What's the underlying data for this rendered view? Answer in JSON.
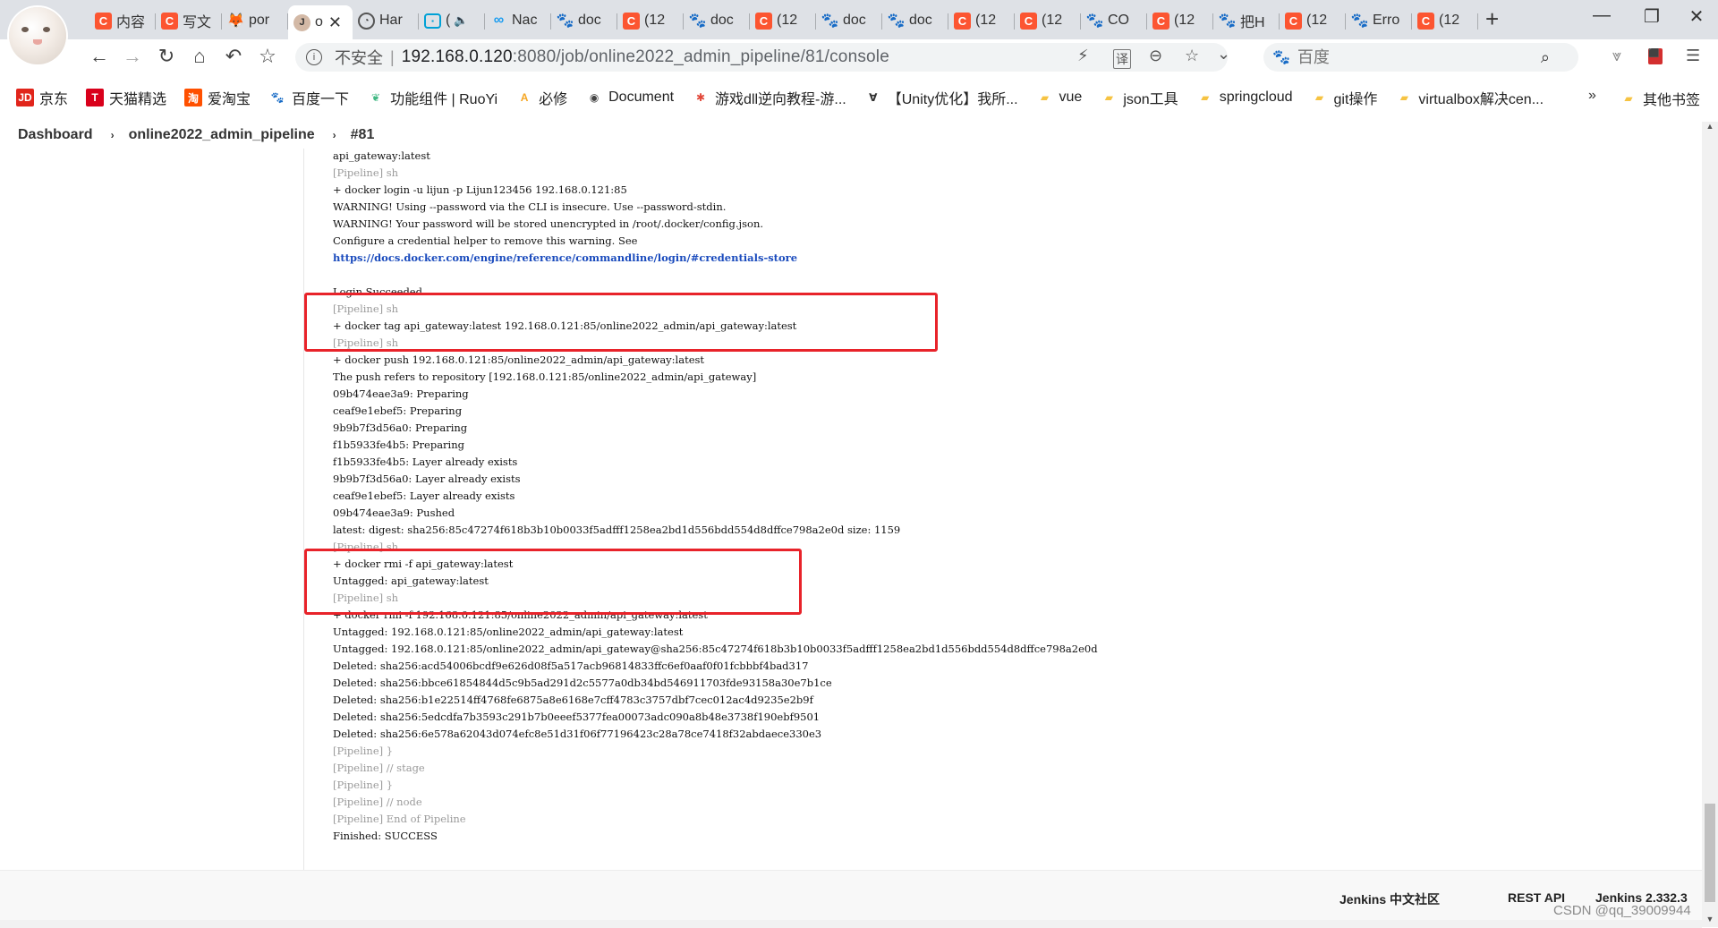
{
  "browser": {
    "tabs": [
      {
        "icon": "csdn",
        "title": "内容"
      },
      {
        "icon": "csdn",
        "title": "写文"
      },
      {
        "icon": "gitlab",
        "title": "por"
      },
      {
        "icon": "jenkins",
        "title": "o",
        "active": true,
        "close": "✕"
      },
      {
        "icon": "github",
        "title": "Har"
      },
      {
        "icon": "bilibili",
        "title": "(",
        "audio": "🔈"
      },
      {
        "icon": "nacos",
        "title": "Nac"
      },
      {
        "icon": "baidu",
        "title": "doc"
      },
      {
        "icon": "csdn",
        "title": "(12"
      },
      {
        "icon": "baidu",
        "title": "doc"
      },
      {
        "icon": "csdn",
        "title": "(12"
      },
      {
        "icon": "baidu",
        "title": "doc"
      },
      {
        "icon": "baidu",
        "title": "doc"
      },
      {
        "icon": "csdn",
        "title": "(12"
      },
      {
        "icon": "csdn",
        "title": "(12"
      },
      {
        "icon": "baidu",
        "title": "CO"
      },
      {
        "icon": "csdn",
        "title": "(12"
      },
      {
        "icon": "baidu",
        "title": "把H"
      },
      {
        "icon": "csdn",
        "title": "(12"
      },
      {
        "icon": "baidu",
        "title": "Erro"
      },
      {
        "icon": "csdn",
        "title": "(12"
      }
    ],
    "new_tab": "+",
    "window": {
      "minimize": "—",
      "restore": "❐",
      "close": "✕"
    },
    "nav": {
      "back": "←",
      "forward": "→",
      "reload": "↻",
      "home": "⌂",
      "undo": "↶",
      "bookmark": "☆"
    },
    "address": {
      "security_label": "不安全",
      "host": "192.168.0.120",
      "rest": ":8080/job/online2022_admin_pipeline/81/console"
    },
    "omni_icons": {
      "lightning": "⚡",
      "translate": "译",
      "zoom": "⊖",
      "star": "☆",
      "dropdown": "⌄"
    },
    "search": {
      "placeholder": "百度",
      "engine_icon": "🐾",
      "go": "⌕"
    },
    "toolbar_right": {
      "extension": "⩔",
      "pdf": "⬛",
      "menu": "☰"
    },
    "bookmarks": [
      {
        "icon": "JD",
        "color": "#e1251b",
        "label": "京东"
      },
      {
        "icon": "T",
        "color": "#d9001b",
        "label": "天猫精选"
      },
      {
        "icon": "淘",
        "color": "#ff5000",
        "label": "爱淘宝"
      },
      {
        "icon": "🐾",
        "color": "#2932e1",
        "label": "百度一下"
      },
      {
        "icon": "❦",
        "color": "#41b883",
        "label": "功能组件 | RuoYi"
      },
      {
        "icon": "A",
        "color": "#f5a623",
        "label": "必修"
      },
      {
        "icon": "◉",
        "color": "#444444",
        "label": "Document"
      },
      {
        "icon": "✱",
        "color": "#e2483a",
        "label": "游戏dll逆向教程-游..."
      },
      {
        "icon": "∀",
        "color": "#333333",
        "label": "【Unity优化】我所..."
      },
      {
        "icon": "▰",
        "color": "#f6c342",
        "label": "vue"
      },
      {
        "icon": "▰",
        "color": "#f6c342",
        "label": "json工具"
      },
      {
        "icon": "▰",
        "color": "#f6c342",
        "label": "springcloud"
      },
      {
        "icon": "▰",
        "color": "#f6c342",
        "label": "git操作"
      },
      {
        "icon": "▰",
        "color": "#f6c342",
        "label": "virtualbox解决cen..."
      }
    ],
    "bookmarks_more": "»",
    "bookmarks_other": "其他书签"
  },
  "jenkins": {
    "breadcrumb": [
      "Dashboard",
      "online2022_admin_pipeline",
      "#81"
    ],
    "console_lines": [
      {
        "text": "api_gateway:latest",
        "style": "normal"
      },
      {
        "text": "[Pipeline] sh",
        "style": "gray"
      },
      {
        "text": "+ docker login -u lijun -p Lijun123456 192.168.0.121:85",
        "style": "normal"
      },
      {
        "text": "WARNING! Using --password via the CLI is insecure. Use --password-stdin.",
        "style": "normal"
      },
      {
        "text": "WARNING! Your password will be stored unencrypted in /root/.docker/config.json.",
        "style": "normal"
      },
      {
        "text": "Configure a credential helper to remove this warning. See",
        "style": "normal"
      },
      {
        "text": "https://docs.docker.com/engine/reference/commandline/login/#credentials-store",
        "style": "link"
      },
      {
        "text": "",
        "style": "blank"
      },
      {
        "text": "Login Succeeded",
        "style": "normal"
      },
      {
        "text": "[Pipeline] sh",
        "style": "gray"
      },
      {
        "text": "+ docker tag api_gateway:latest 192.168.0.121:85/online2022_admin/api_gateway:latest",
        "style": "normal"
      },
      {
        "text": "[Pipeline] sh",
        "style": "gray"
      },
      {
        "text": "+ docker push 192.168.0.121:85/online2022_admin/api_gateway:latest",
        "style": "normal"
      },
      {
        "text": "The push refers to repository [192.168.0.121:85/online2022_admin/api_gateway]",
        "style": "normal"
      },
      {
        "text": "09b474eae3a9: Preparing",
        "style": "normal"
      },
      {
        "text": "ceaf9e1ebef5: Preparing",
        "style": "normal"
      },
      {
        "text": "9b9b7f3d56a0: Preparing",
        "style": "normal"
      },
      {
        "text": "f1b5933fe4b5: Preparing",
        "style": "normal"
      },
      {
        "text": "f1b5933fe4b5: Layer already exists",
        "style": "normal"
      },
      {
        "text": "9b9b7f3d56a0: Layer already exists",
        "style": "normal"
      },
      {
        "text": "ceaf9e1ebef5: Layer already exists",
        "style": "normal"
      },
      {
        "text": "09b474eae3a9: Pushed",
        "style": "normal"
      },
      {
        "text": "latest: digest: sha256:85c47274f618b3b10b0033f5adfff1258ea2bd1d556bdd554d8dffce798a2e0d size: 1159",
        "style": "normal"
      },
      {
        "text": "[Pipeline] sh",
        "style": "gray"
      },
      {
        "text": "+ docker rmi -f api_gateway:latest",
        "style": "normal"
      },
      {
        "text": "Untagged: api_gateway:latest",
        "style": "normal"
      },
      {
        "text": "[Pipeline] sh",
        "style": "gray"
      },
      {
        "text": "+ docker rmi -f 192.168.0.121:85/online2022_admin/api_gateway:latest",
        "style": "normal"
      },
      {
        "text": "Untagged: 192.168.0.121:85/online2022_admin/api_gateway:latest",
        "style": "normal"
      },
      {
        "text": "Untagged: 192.168.0.121:85/online2022_admin/api_gateway@sha256:85c47274f618b3b10b0033f5adfff1258ea2bd1d556bdd554d8dffce798a2e0d",
        "style": "normal"
      },
      {
        "text": "Deleted: sha256:acd54006bcdf9e626d08f5a517acb96814833ffc6ef0aaf0f01fcbbbf4bad317",
        "style": "normal"
      },
      {
        "text": "Deleted: sha256:bbce61854844d5c9b5ad291d2c5577a0db34bd546911703fde93158a30e7b1ce",
        "style": "normal"
      },
      {
        "text": "Deleted: sha256:b1e22514ff4768fe6875a8e6168e7cff4783c3757dbf7cec012ac4d9235e2b9f",
        "style": "normal"
      },
      {
        "text": "Deleted: sha256:5edcdfa7b3593c291b7b0eeef5377fea00073adc090a8b48e3738f190ebf9501",
        "style": "normal"
      },
      {
        "text": "Deleted: sha256:6e578a62043d074efc8e51d31f06f77196423c28a78ce7418f32abdaece330e3",
        "style": "normal"
      },
      {
        "text": "[Pipeline] }",
        "style": "gray"
      },
      {
        "text": "[Pipeline] // stage",
        "style": "gray"
      },
      {
        "text": "[Pipeline] }",
        "style": "gray"
      },
      {
        "text": "[Pipeline] // node",
        "style": "gray"
      },
      {
        "text": "[Pipeline] End of Pipeline",
        "style": "gray"
      },
      {
        "text": "Finished: SUCCESS",
        "style": "normal"
      }
    ],
    "annotation_color": "#e8232a",
    "footer": {
      "community": "Jenkins 中文社区",
      "rest_api": "REST API",
      "version": "Jenkins 2.332.3"
    }
  },
  "watermark": "CSDN @qq_39009944"
}
